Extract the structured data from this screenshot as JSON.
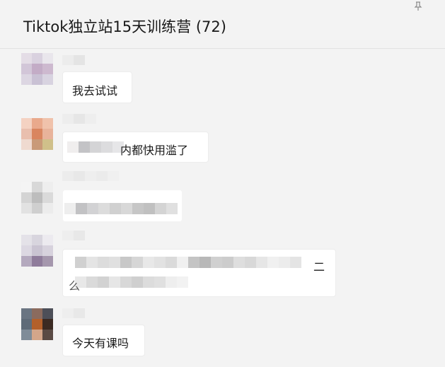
{
  "window": {
    "title": "Tiktok独立站15天训练营 (72)"
  },
  "messages": [
    {
      "text": "我去试试"
    },
    {
      "text": "内都快用滥了"
    },
    {
      "text": ""
    },
    {
      "text_right": "二",
      "text_line2": "么"
    },
    {
      "text": "今天有课吗"
    }
  ]
}
